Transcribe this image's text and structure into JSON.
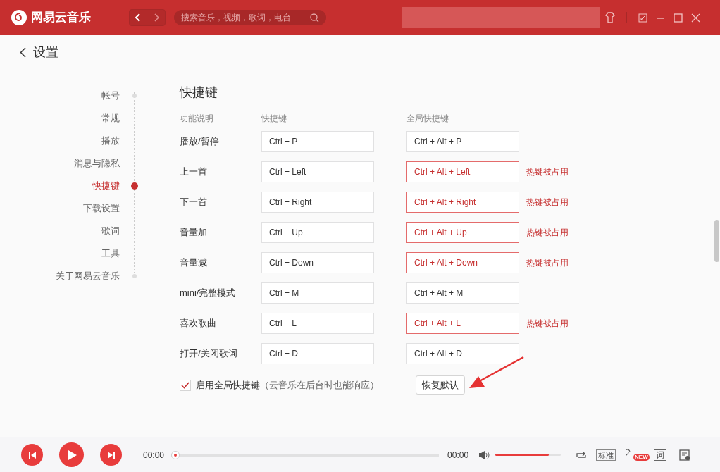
{
  "header": {
    "app_name": "网易云音乐",
    "search": {
      "placeholder": "搜索音乐，视频，歌词，电台"
    }
  },
  "page_title": "设置",
  "nav": [
    {
      "label": "帐号",
      "selected": false
    },
    {
      "label": "常规",
      "selected": false
    },
    {
      "label": "播放",
      "selected": false
    },
    {
      "label": "消息与隐私",
      "selected": false
    },
    {
      "label": "快捷键",
      "selected": true
    },
    {
      "label": "下载设置",
      "selected": false
    },
    {
      "label": "歌词",
      "selected": false
    },
    {
      "label": "工具",
      "selected": false
    },
    {
      "label": "关于网易云音乐",
      "selected": false
    }
  ],
  "section_title": "快捷键",
  "columns": [
    "功能说明",
    "快捷键",
    "全局快捷键"
  ],
  "rows": [
    {
      "name": "播放/暂停",
      "shortcut": "Ctrl + P",
      "global": "Ctrl + Alt + P",
      "occupied": false
    },
    {
      "name": "上一首",
      "shortcut": "Ctrl + Left",
      "global": "Ctrl + Alt + Left",
      "occupied": true,
      "warning": "热键被占用"
    },
    {
      "name": "下一首",
      "shortcut": "Ctrl + Right",
      "global": "Ctrl + Alt + Right",
      "occupied": true,
      "warning": "热键被占用"
    },
    {
      "name": "音量加",
      "shortcut": "Ctrl + Up",
      "global": "Ctrl + Alt + Up",
      "occupied": true,
      "warning": "热键被占用"
    },
    {
      "name": "音量减",
      "shortcut": "Ctrl + Down",
      "global": "Ctrl + Alt + Down",
      "occupied": true,
      "warning": "热键被占用"
    },
    {
      "name": "mini/完整模式",
      "shortcut": "Ctrl + M",
      "global": "Ctrl + Alt + M",
      "occupied": false
    },
    {
      "name": "喜欢歌曲",
      "shortcut": "Ctrl + L",
      "global": "Ctrl + Alt + L",
      "occupied": true,
      "warning": "热键被占用"
    },
    {
      "name": "打开/关闭歌词",
      "shortcut": "Ctrl + D",
      "global": "Ctrl + Alt + D",
      "occupied": false
    }
  ],
  "global_toggle": {
    "label": "启用全局快捷键",
    "hint": "（云音乐在后台时也能响应）",
    "checked": true
  },
  "reset_button": "恢复默认",
  "player": {
    "elapsed": "00:00",
    "total": "00:00",
    "progress": {
      "level": 0
    },
    "volume": {
      "level": 0.82
    },
    "quality": "标准",
    "lyrics_button": "词",
    "new_badge": "NEW"
  }
}
